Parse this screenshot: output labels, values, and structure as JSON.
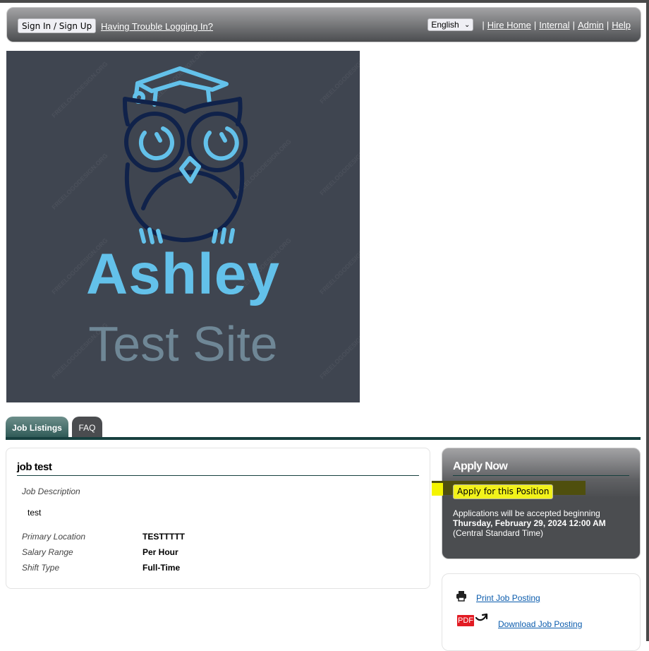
{
  "header": {
    "sign_in_label": "Sign In / Sign Up",
    "trouble_link": "Having Trouble Logging In?",
    "language": "English",
    "links": [
      "Hire Home",
      "Internal",
      "Admin",
      "Help"
    ],
    "separator": "|"
  },
  "logo": {
    "title": "Ashley",
    "subtitle": "Test Site",
    "watermark": "FREELOGODESIGN.ORG",
    "colors": {
      "background": "#3f4550",
      "accent": "#63c1ea",
      "outline": "#10224a",
      "subtitle": "#6f8796"
    }
  },
  "tabs": [
    {
      "label": "Job Listings",
      "active": true
    },
    {
      "label": "FAQ",
      "active": false
    }
  ],
  "job": {
    "title": "job test",
    "description_label": "Job Description",
    "description": "test",
    "fields": [
      {
        "label": "Primary Location",
        "value": "TESTTTTT"
      },
      {
        "label": "Salary Range",
        "value": "Per Hour"
      },
      {
        "label": "Shift Type",
        "value": "Full-Time"
      }
    ]
  },
  "apply": {
    "title": "Apply Now",
    "button_label": "Apply for this Position",
    "info_line1": "Applications will be accepted beginning",
    "info_date": "Thursday, February 29, 2024 12:00 AM",
    "info_tz": "(Central Standard Time)"
  },
  "actions": {
    "print_label": "Print Job Posting",
    "pdf_badge": "PDF",
    "download_label": "Download Job Posting"
  },
  "colors": {
    "tab_rule": "#17403f",
    "link_blue": "#0b5cad",
    "highlight": "#f2f21a",
    "pdf_red": "#e21b23"
  }
}
